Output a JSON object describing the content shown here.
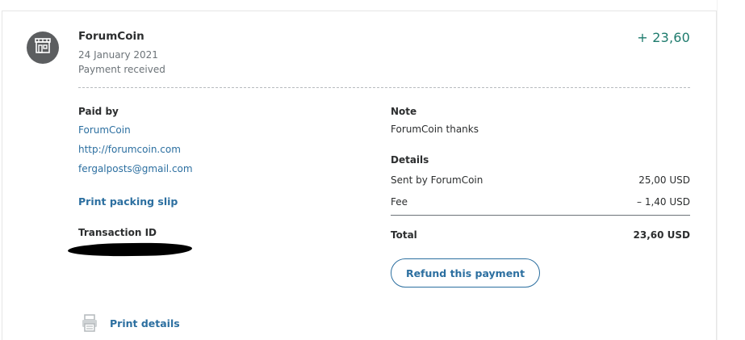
{
  "transaction": {
    "merchant": "ForumCoin",
    "date": "24 January 2021",
    "status": "Payment received",
    "amount": "+ 23,60"
  },
  "paid_by": {
    "label": "Paid by",
    "name": "ForumCoin",
    "website": "http://forumcoin.com",
    "email": "fergalposts@gmail.com",
    "print_slip": "Print packing slip"
  },
  "transaction_id": {
    "label": "Transaction ID"
  },
  "note": {
    "label": "Note",
    "text": "ForumCoin thanks"
  },
  "details": {
    "label": "Details",
    "rows": [
      {
        "label": "Sent by ForumCoin",
        "value": "25,00 USD"
      },
      {
        "label": "Fee",
        "value": "– 1,40 USD"
      }
    ],
    "total_label": "Total",
    "total_value": "23,60 USD"
  },
  "actions": {
    "refund": "Refund this payment",
    "print_details": "Print details"
  },
  "colors": {
    "amount": "#1e7b6d",
    "link": "#2c6fa0",
    "avatar": "#5c5e60"
  },
  "icons": {
    "avatar": "store-icon",
    "print": "printer-icon"
  }
}
